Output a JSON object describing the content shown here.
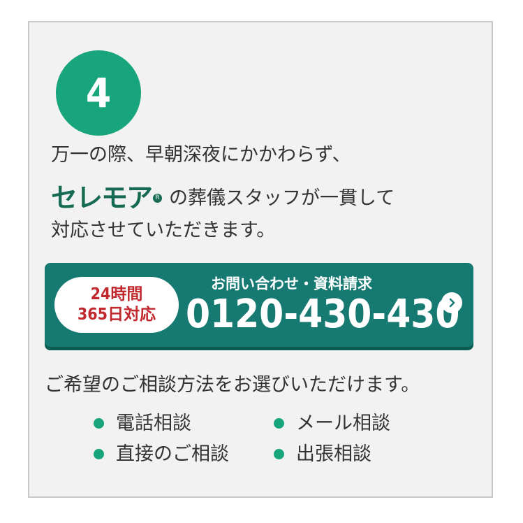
{
  "step": {
    "number": "4"
  },
  "intro": {
    "line1": "万一の際、早朝深夜にかかわらず、",
    "brand": "セレモア",
    "brand_mark": "R",
    "line2_rest": "の葬儀スタッフが一貫して",
    "line3": "対応させていただきます。"
  },
  "cta": {
    "hours_line1": "24時間",
    "hours_line2": "365日対応",
    "caption": "お問い合わせ・資料請求",
    "phone": "0120-430-430",
    "arrow_icon": "chevron-right-icon"
  },
  "methods": {
    "lead": "ご希望のご相談方法をお選びいただけます。",
    "items": [
      "電話相談",
      "メール相談",
      "直接のご相談",
      "出張相談"
    ]
  },
  "colors": {
    "accent_green": "#19a57b",
    "brand_green": "#166b52",
    "cta_teal": "#167a72",
    "hours_red": "#c0282d",
    "card_bg": "#f2f2f2"
  }
}
